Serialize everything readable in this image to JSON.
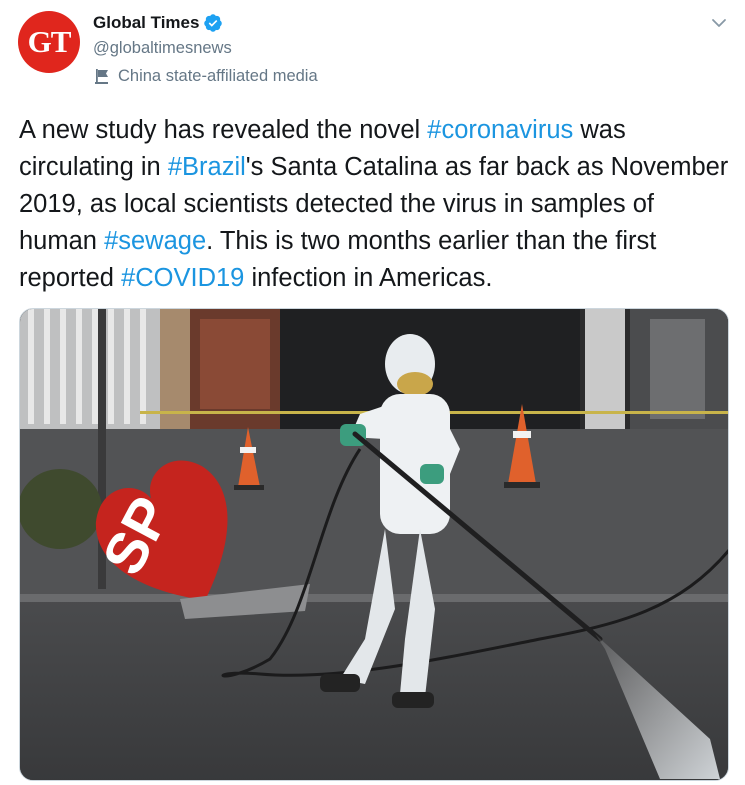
{
  "author": {
    "avatar_text": "GT",
    "avatar_color": "#e0261d",
    "name": "Global Times",
    "verified_icon": "verified-badge-icon",
    "handle": "@globaltimesnews",
    "label": "China state-affiliated media",
    "label_icon": "flag-icon"
  },
  "menu": {
    "icon": "chevron-down-icon"
  },
  "tweet": {
    "parts": [
      {
        "text": "A new study has revealed the novel ",
        "link": false
      },
      {
        "text": "#coronavirus",
        "link": true
      },
      {
        "text": " was circulating in ",
        "link": false
      },
      {
        "text": "#Brazil",
        "link": true
      },
      {
        "text": "'s Santa Catalina as far back as November 2019, as local scientists detected the virus in samples of human ",
        "link": false
      },
      {
        "text": "#sewage",
        "link": true
      },
      {
        "text": ". This is two months earlier than the first reported ",
        "link": false
      },
      {
        "text": "#COVID19",
        "link": true
      },
      {
        "text": " infection in Americas.",
        "link": false
      }
    ]
  },
  "media": {
    "sign_text": "SP"
  },
  "colors": {
    "link": "#1b95e0",
    "secondary_text": "#657786",
    "verified": "#1da1f2"
  }
}
